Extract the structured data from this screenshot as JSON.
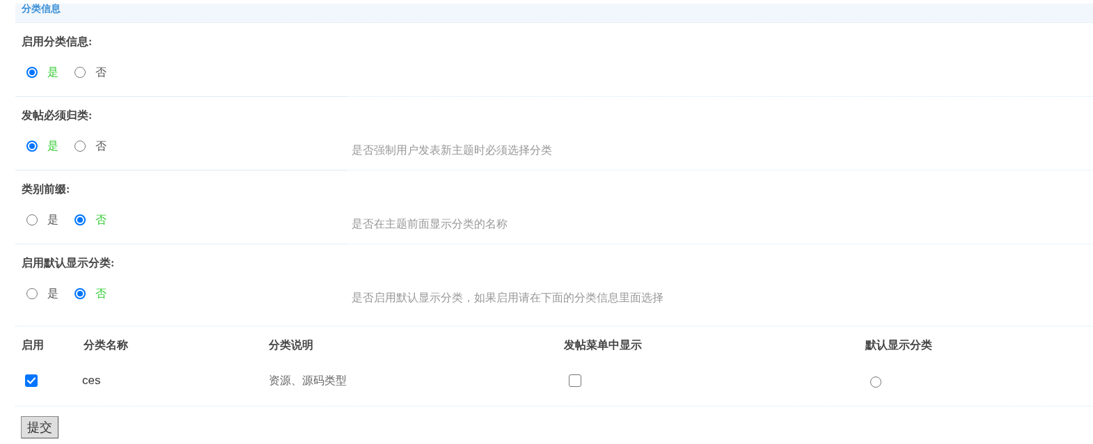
{
  "section": {
    "title": "分类信息"
  },
  "settings": [
    {
      "label": "启用分类信息:",
      "options": [
        {
          "label": "是",
          "selected": true
        },
        {
          "label": "否",
          "selected": false
        }
      ]
    },
    {
      "label": "发帖必须归类:",
      "options": [
        {
          "label": "是",
          "selected": true
        },
        {
          "label": "否",
          "selected": false
        }
      ],
      "description": "是否强制用户发表新主题时必须选择分类"
    },
    {
      "label": "类别前缀:",
      "options": [
        {
          "label": "是",
          "selected": false
        },
        {
          "label": "否",
          "selected": true
        }
      ],
      "description": "是否在主题前面显示分类的名称"
    },
    {
      "label": "启用默认显示分类:",
      "options": [
        {
          "label": "是",
          "selected": false
        },
        {
          "label": "否",
          "selected": true
        }
      ],
      "description": "是否启用默认显示分类，如果启用请在下面的分类信息里面选择"
    }
  ],
  "table": {
    "columns": [
      "启用",
      "分类名称",
      "分类说明",
      "发帖菜单中显示",
      "默认显示分类"
    ],
    "rows": [
      {
        "enabled": true,
        "name": "ces",
        "description": "资源、源码类型",
        "show_in_menu": false,
        "default_selected": false
      }
    ]
  },
  "submit_button": {
    "label": "提交"
  }
}
